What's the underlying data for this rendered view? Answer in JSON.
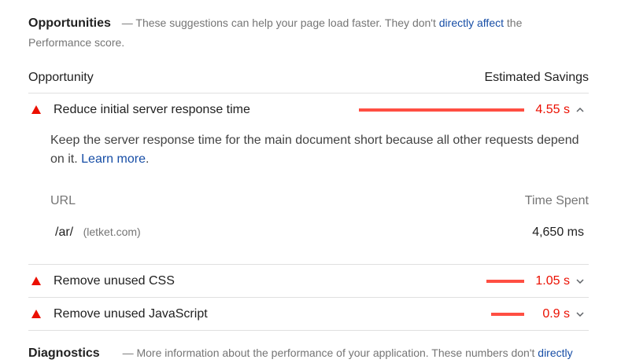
{
  "opportunities": {
    "title": "Opportunities",
    "description_prefix": "— These suggestions can help your page load faster. They don't",
    "description_link": "directly affect",
    "description_suffix": "the",
    "description_line2": "Performance score.",
    "column_opportunity": "Opportunity",
    "column_savings": "Estimated Savings",
    "audits": [
      {
        "title": "Reduce initial server response time",
        "savings": "4.55 s",
        "bar_fraction": 1.0,
        "expanded": true,
        "description": "Keep the server response time for the main document short because all other requests depend on it.",
        "learn_more": "Learn more",
        "learn_more_suffix": ".",
        "table": {
          "col_url": "URL",
          "col_time": "Time Spent",
          "rows": [
            {
              "path": "/ar/",
              "host": "(letket.com)",
              "time": "4,650 ms"
            }
          ]
        }
      },
      {
        "title": "Remove unused CSS",
        "savings": "1.05 s",
        "bar_fraction": 0.23,
        "expanded": false
      },
      {
        "title": "Remove unused JavaScript",
        "savings": "0.9 s",
        "bar_fraction": 0.2,
        "expanded": false
      }
    ]
  },
  "diagnostics": {
    "title": "Diagnostics",
    "description": "— More information about the performance of your application. These numbers don't",
    "description_link": "directly"
  },
  "colors": {
    "fail": "#eb0f00",
    "bar": "#ff4e42",
    "link": "#174ea6"
  },
  "icons": {
    "fail": "fail-triangle-icon",
    "expanded": "chevron-up-icon",
    "collapsed": "chevron-down-icon"
  }
}
